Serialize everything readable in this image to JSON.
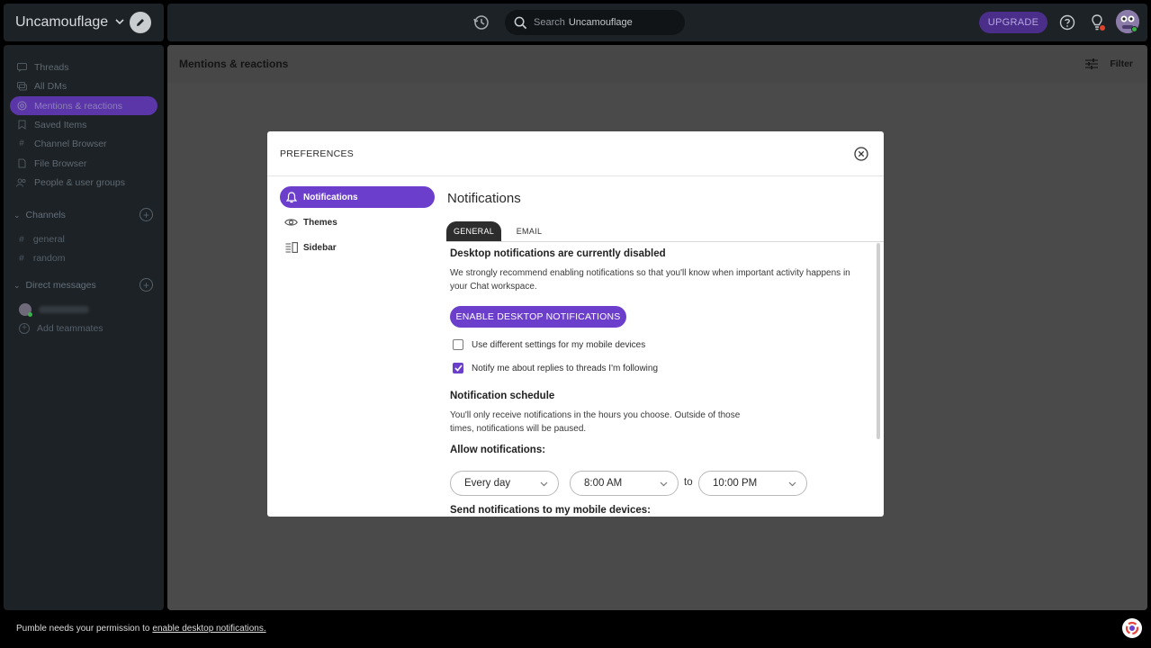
{
  "workspace": {
    "name": "Uncamouflage"
  },
  "topbar": {
    "search_label": "Search",
    "search_workspace": "Uncamouflage",
    "upgrade_label": "UPGRADE"
  },
  "sidebar": {
    "items": [
      {
        "label": "Threads",
        "icon": "threads-icon"
      },
      {
        "label": "All DMs",
        "icon": "dms-icon"
      },
      {
        "label": "Mentions & reactions",
        "icon": "at-icon"
      },
      {
        "label": "Saved Items",
        "icon": "bookmark-icon"
      },
      {
        "label": "Channel Browser",
        "icon": "channel-browser-icon"
      },
      {
        "label": "File Browser",
        "icon": "file-icon"
      },
      {
        "label": "People & user groups",
        "icon": "people-icon"
      }
    ],
    "channels_heading": "Channels",
    "channels": [
      "general",
      "random"
    ],
    "dm_heading": "Direct messages",
    "add_teammates": "Add teammates"
  },
  "main": {
    "title": "Mentions & reactions",
    "filter_label": "Filter"
  },
  "modal": {
    "title": "PREFERENCES",
    "nav": [
      {
        "label": "Notifications",
        "icon": "bell-icon"
      },
      {
        "label": "Themes",
        "icon": "eye-icon"
      },
      {
        "label": "Sidebar",
        "icon": "sidebar-layout-icon"
      }
    ],
    "content_title": "Notifications",
    "tabs": [
      "GENERAL",
      "EMAIL"
    ],
    "disabled_heading": "Desktop notifications are currently disabled",
    "disabled_text": "We strongly recommend enabling notifications so that you'll know when important activity happens in your Chat workspace.",
    "enable_button": "ENABLE DESKTOP NOTIFICATIONS",
    "checkboxes": [
      {
        "label": "Use different settings for my mobile devices",
        "checked": false
      },
      {
        "label": "Notify me about replies to threads I'm following",
        "checked": true
      }
    ],
    "schedule_heading": "Notification schedule",
    "schedule_text": "You'll only receive notifications in the hours you choose. Outside of those times, notifications will be paused.",
    "allow_heading": "Allow notifications:",
    "day_select": "Every day",
    "from_select": "8:00 AM",
    "to_label": "to",
    "to_select": "10:00 PM",
    "mobile_heading": "Send notifications to my mobile devices:"
  },
  "bottombar": {
    "text": "Pumble needs your permission to",
    "link": "enable desktop notifications."
  },
  "colors": {
    "accent": "#6b3fcb",
    "sidebar_bg": "#1d2226",
    "overlay_bg": "#4a4a4a"
  }
}
